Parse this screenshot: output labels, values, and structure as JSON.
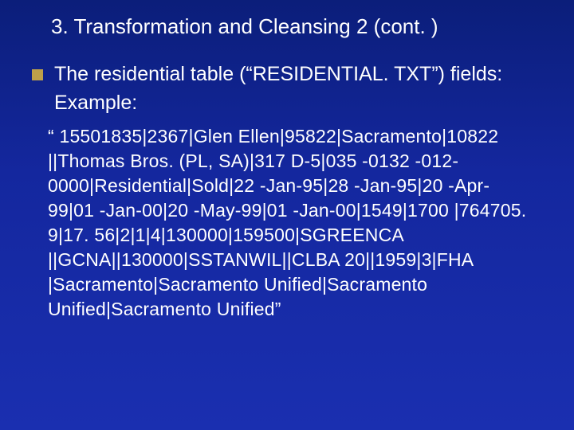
{
  "title": "3. Transformation and Cleansing 2 (cont. )",
  "intro": "The residential table (“RESIDENTIAL. TXT”) fields:",
  "example_label": "Example:",
  "example_body": "“ 15501835|2367|Glen Ellen|95822|Sacramento|10822 ||Thomas Bros. (PL, SA)|317 D-5|035 -0132 -012- 0000|Residential|Sold|22 -Jan-95|28 -Jan-95|20 -Apr- 99|01 -Jan-00|20 -May-99|01 -Jan-00|1549|1700 |764705. 9|17. 56|2|1|4|130000|159500|SGREENCA ||GCNA||130000|SSTANWIL||CLBA 20||1959|3|FHA |Sacramento|Sacramento Unified|Sacramento Unified|Sacramento Unified”"
}
